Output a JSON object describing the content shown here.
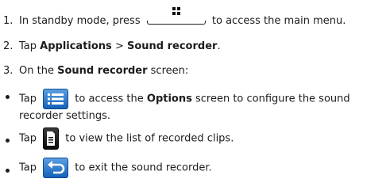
{
  "step1": {
    "num": "1.",
    "before": "In standby mode, press",
    "after": "to access the main menu."
  },
  "step2": {
    "num": "2.",
    "before": "Tap ",
    "b1": "Applications",
    "mid": " > ",
    "b2": "Sound recorder",
    "end": "."
  },
  "step3": {
    "num": "3.",
    "before": "On the ",
    "b1": "Sound recorder",
    "after": " screen:"
  },
  "bullet1": {
    "before": "Tap",
    "mid": "to access the ",
    "b1": "Options",
    "after": " screen to configure the sound recorder settings."
  },
  "bullet2": {
    "before": "Tap",
    "after": "to view the list of recorded clips."
  },
  "bullet3": {
    "before": "Tap",
    "after": "to exit the sound recorder."
  },
  "icons": {
    "home": "home-menu-key-icon",
    "options": "options-list-icon",
    "clips": "document-icon",
    "back": "back-arrow-icon"
  },
  "colors": {
    "icon_blue_top": "#5b9fe2",
    "icon_blue_bottom": "#1561b8"
  }
}
